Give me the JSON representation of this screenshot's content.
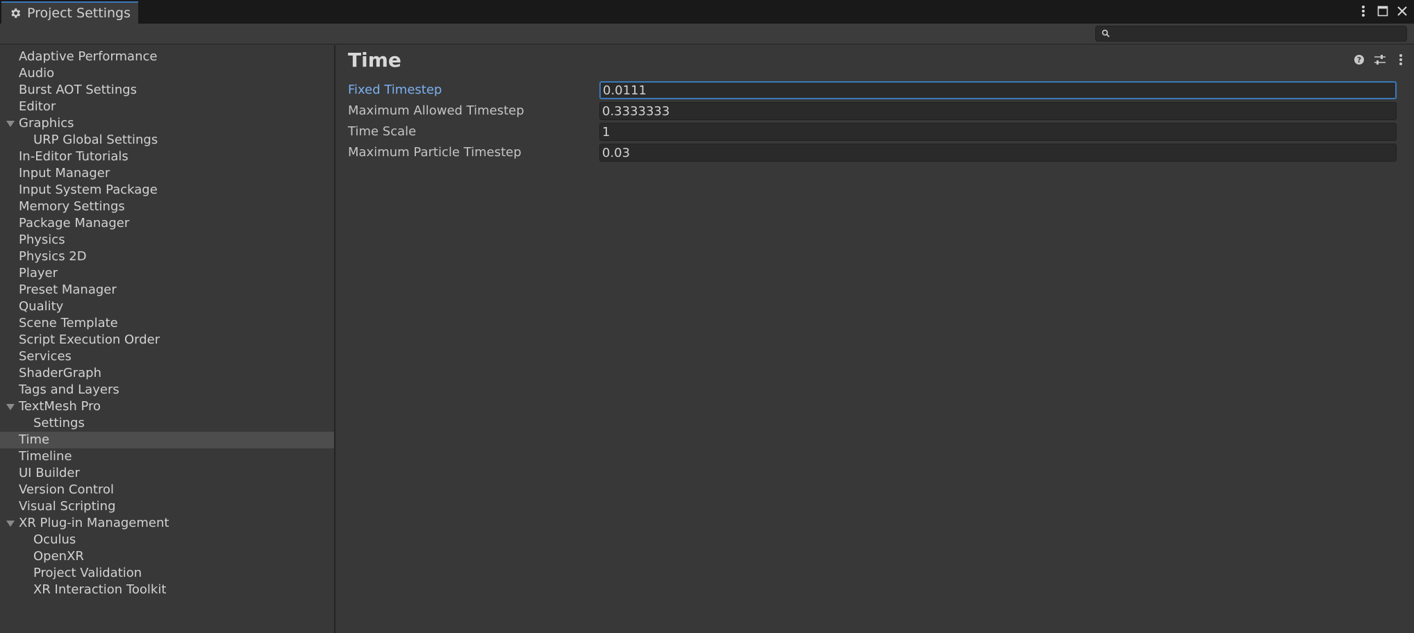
{
  "window": {
    "tab_title": "Project Settings"
  },
  "search": {
    "value": "",
    "placeholder": ""
  },
  "sidebar": {
    "items": [
      {
        "label": "Adaptive Performance"
      },
      {
        "label": "Audio"
      },
      {
        "label": "Burst AOT Settings"
      },
      {
        "label": "Editor"
      },
      {
        "label": "Graphics",
        "expanded": true
      },
      {
        "label": "URP Global Settings",
        "child": true
      },
      {
        "label": "In-Editor Tutorials"
      },
      {
        "label": "Input Manager"
      },
      {
        "label": "Input System Package"
      },
      {
        "label": "Memory Settings"
      },
      {
        "label": "Package Manager"
      },
      {
        "label": "Physics"
      },
      {
        "label": "Physics 2D"
      },
      {
        "label": "Player"
      },
      {
        "label": "Preset Manager"
      },
      {
        "label": "Quality"
      },
      {
        "label": "Scene Template"
      },
      {
        "label": "Script Execution Order"
      },
      {
        "label": "Services"
      },
      {
        "label": "ShaderGraph"
      },
      {
        "label": "Tags and Layers"
      },
      {
        "label": "TextMesh Pro",
        "expanded": true
      },
      {
        "label": "Settings",
        "child": true
      },
      {
        "label": "Time",
        "selected": true
      },
      {
        "label": "Timeline"
      },
      {
        "label": "UI Builder"
      },
      {
        "label": "Version Control"
      },
      {
        "label": "Visual Scripting"
      },
      {
        "label": "XR Plug-in Management",
        "expanded": true
      },
      {
        "label": "Oculus",
        "child": true
      },
      {
        "label": "OpenXR",
        "child": true
      },
      {
        "label": "Project Validation",
        "child": true
      },
      {
        "label": "XR Interaction Toolkit",
        "child": true
      }
    ]
  },
  "main": {
    "title": "Time",
    "properties": [
      {
        "label": "Fixed Timestep",
        "value": "0.0111"
      },
      {
        "label": "Maximum Allowed Timestep",
        "value": "0.3333333"
      },
      {
        "label": "Time Scale",
        "value": "1"
      },
      {
        "label": "Maximum Particle Timestep",
        "value": "0.03"
      }
    ]
  },
  "colors": {
    "accent": "#3a79bb",
    "active_label": "#7bb0f0",
    "background": "#383838",
    "selected_row": "#4d4d4d"
  },
  "icons": {
    "tab": "gear-icon",
    "window": [
      "kebab-menu-icon",
      "maximize-icon",
      "close-icon"
    ],
    "search": "search-icon",
    "header": [
      "help-icon",
      "preset-sliders-icon",
      "kebab-menu-icon"
    ]
  }
}
